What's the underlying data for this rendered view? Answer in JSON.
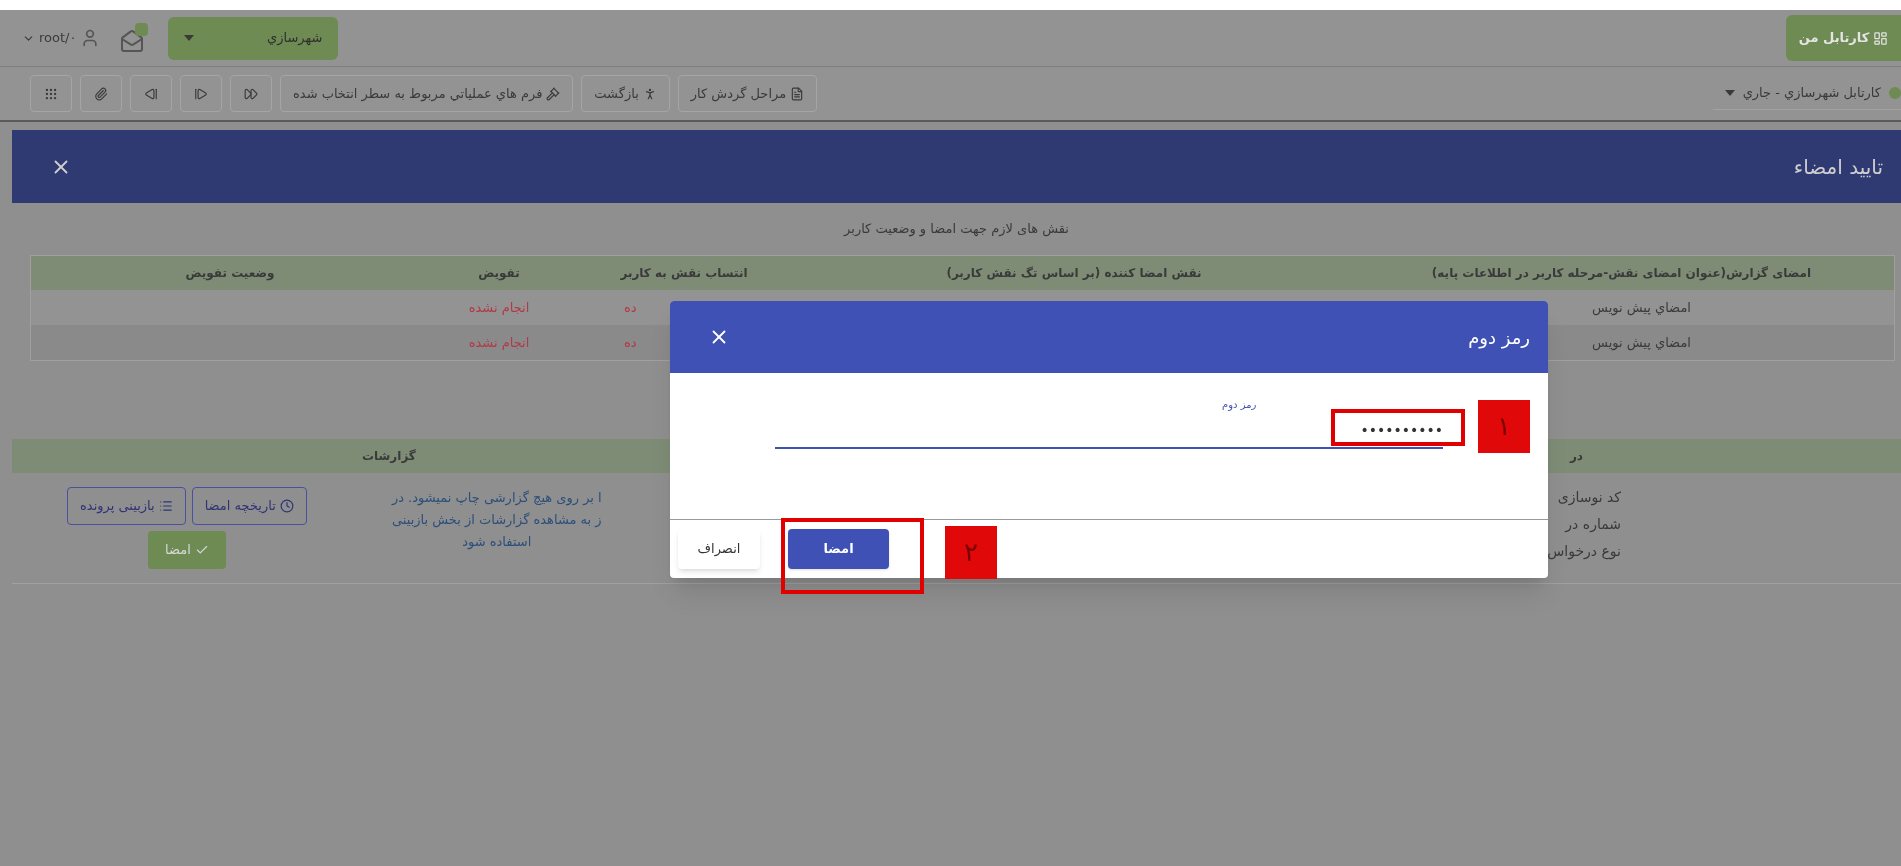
{
  "top_bar": {
    "my_cartable": "کارتابل من",
    "unit_select": "شهرسازي",
    "user": "root/۰"
  },
  "toolbar": {
    "cartable_select": "کارتابل شهرسازي - جاري",
    "buttons": [
      {
        "kind": "workflow",
        "label": "مراحل گردش کار"
      },
      {
        "kind": "back",
        "label": "بازگشت"
      },
      {
        "kind": "forms",
        "label": "فرم هاي عملياتي مربوط به سطر انتخاب شده"
      },
      {
        "kind": "fastforward"
      },
      {
        "kind": "last"
      },
      {
        "kind": "first"
      },
      {
        "kind": "attach"
      },
      {
        "kind": "grid"
      }
    ]
  },
  "panel": {
    "title": "تایید امضاء",
    "caption": "نقش های لازم جهت امضا و وضعیت کاربر"
  },
  "roles_table": {
    "columns": [
      "امضای گزارش(عنوان امضای نقش-مرحله کاربر در اطلاعات پایه)",
      "نقش امضا کننده (بر اساس تگ نقش کاربر)",
      "انتساب نقش به کاربر",
      "تفویض",
      "وضعیت تفویض"
    ],
    "rows": [
      {
        "report_sign": "امضاي پيش نويس",
        "assignment": "ده",
        "delegation": "انجام نشده"
      },
      {
        "report_sign": "امضاي پيش نويس",
        "assignment": "ده",
        "delegation": "انجام نشده"
      }
    ]
  },
  "details": {
    "header": "در",
    "labels": [
      "کد نوسازی",
      "شماره در",
      "نوع درخواس"
    ]
  },
  "reports": {
    "header": "گزارشات",
    "note_lines": [
      "ا بر روی هیچ گزارشی چاپ نمیشود. در",
      "ز به مشاهده گزارشات از بخش بازبینی",
      "استفاده شود"
    ],
    "buttons": [
      {
        "kind": "history",
        "label": "تاریخچه امضا"
      },
      {
        "kind": "review",
        "label": "بازبینی پرونده"
      },
      {
        "kind": "sign",
        "label": "امضا"
      }
    ]
  },
  "dialog": {
    "title": "رمز دوم",
    "field": {
      "label": "رمز دوم",
      "value": "••••••••••"
    },
    "buttons": [
      {
        "kind": "primary",
        "label": "امضا"
      },
      {
        "kind": "secondary",
        "label": "انصراف"
      }
    ]
  },
  "annotations": [
    {
      "label": "۱"
    },
    {
      "label": "۲"
    }
  ]
}
